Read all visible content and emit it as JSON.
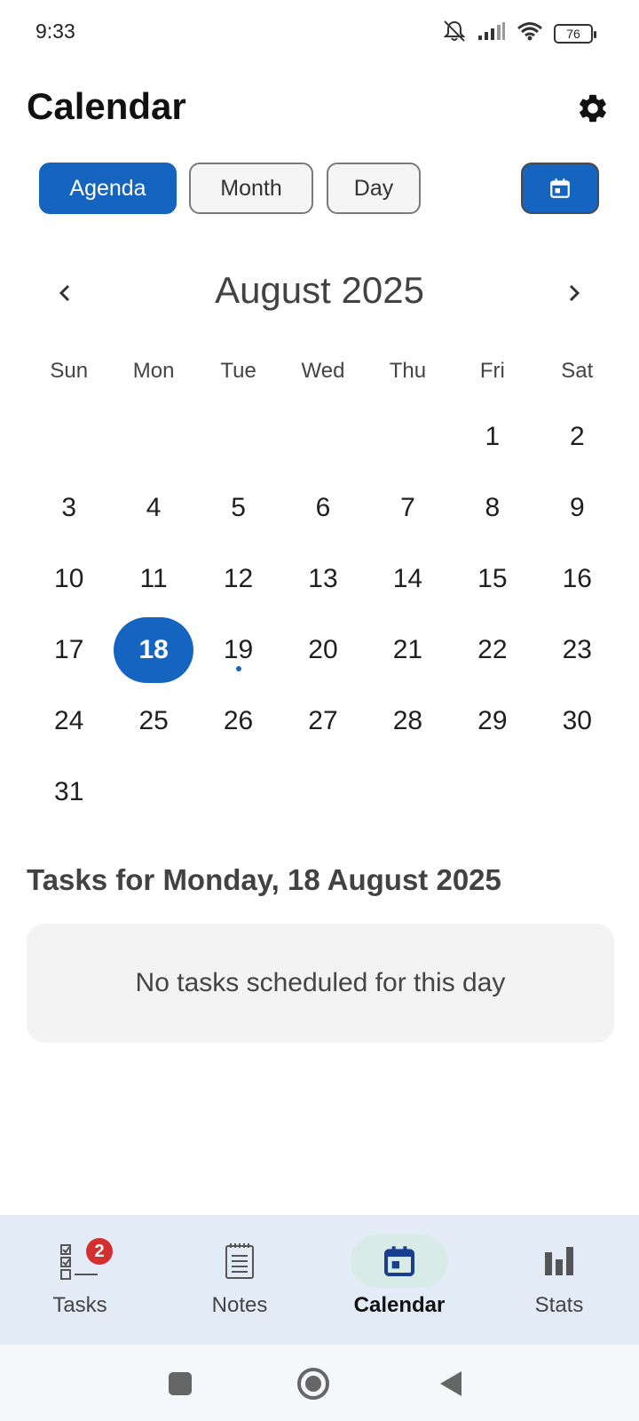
{
  "status_bar": {
    "time": "9:33",
    "battery": "76"
  },
  "header": {
    "title": "Calendar"
  },
  "view_buttons": {
    "agenda": "Agenda",
    "month": "Month",
    "day": "Day"
  },
  "calendar": {
    "month_label": "August 2025",
    "weekdays": [
      "Sun",
      "Mon",
      "Tue",
      "Wed",
      "Thu",
      "Fri",
      "Sat"
    ],
    "leading_blank_days": 5,
    "days": [
      "1",
      "2",
      "3",
      "4",
      "5",
      "6",
      "7",
      "8",
      "9",
      "10",
      "11",
      "12",
      "13",
      "14",
      "15",
      "16",
      "17",
      "18",
      "19",
      "20",
      "21",
      "22",
      "23",
      "24",
      "25",
      "26",
      "27",
      "28",
      "29",
      "30",
      "31"
    ],
    "selected_day": "18",
    "days_with_tasks": [
      "19"
    ]
  },
  "tasks": {
    "heading": "Tasks for Monday, 18 August 2025",
    "empty_message": "No tasks scheduled for this day"
  },
  "bottom_nav": {
    "items": [
      {
        "label": "Tasks",
        "icon": "checklist-icon",
        "badge": "2"
      },
      {
        "label": "Notes",
        "icon": "notes-icon"
      },
      {
        "label": "Calendar",
        "icon": "calendar-icon",
        "active": true
      },
      {
        "label": "Stats",
        "icon": "bar-chart-icon"
      }
    ]
  },
  "colors": {
    "accent": "#1565c0",
    "badge": "#d32f2f",
    "nav_background": "#e3ecf6"
  }
}
